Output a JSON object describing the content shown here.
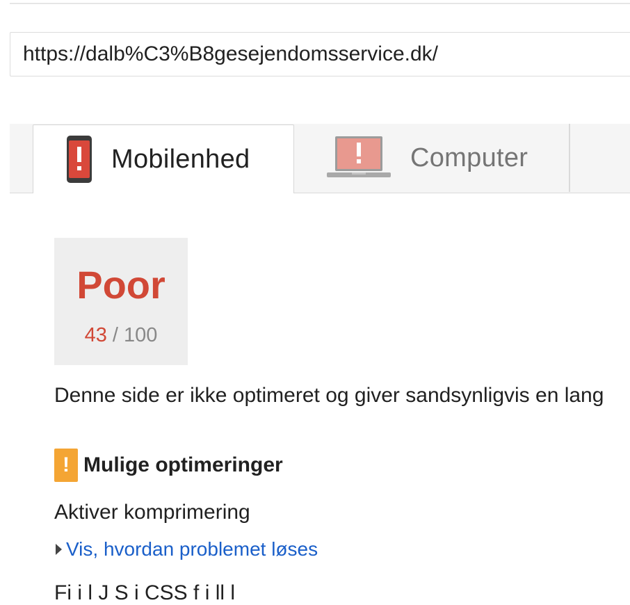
{
  "url_field": {
    "value": "https://dalb%C3%B8gesejendomsservice.dk/"
  },
  "tabs": [
    {
      "label": "Mobilenhed",
      "icon": "phone-warning-icon",
      "selected": true
    },
    {
      "label": "Computer",
      "icon": "laptop-warning-icon",
      "selected": false
    }
  ],
  "score": {
    "grade": "Poor",
    "value": "43",
    "separator": " / ",
    "max": "100"
  },
  "summary_text": "Denne side er ikke optimeret og giver sandsynligvis en lang",
  "section": {
    "title": "Mulige optimeringer",
    "icon_glyph": "!"
  },
  "rule": {
    "title": "Aktiver komprimering",
    "show_how_label": "Vis, hvordan problemet løses"
  },
  "truncated_line": "Fi                  i                    l       J    S   i        CSS f     i    ll    l",
  "colors": {
    "poor_red": "#d14836",
    "warning_orange": "#f4a534",
    "link_blue": "#1a5fc9"
  }
}
